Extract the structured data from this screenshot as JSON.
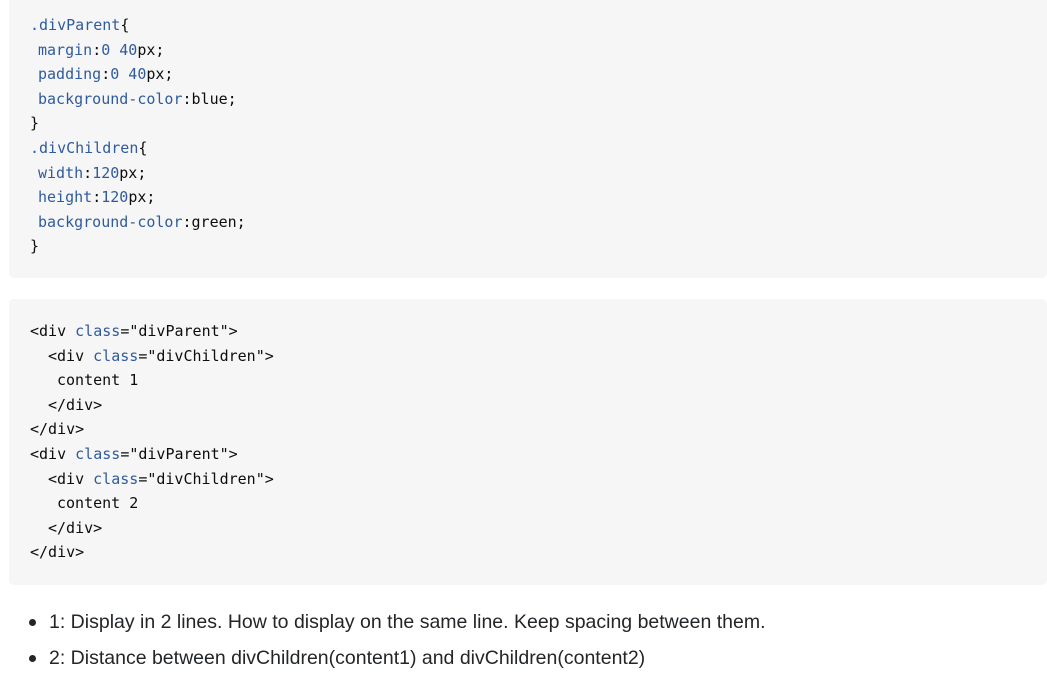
{
  "css_code": {
    "lines": [
      {
        "parts": [
          {
            "t": ".divParent",
            "c": "kw"
          },
          {
            "t": "{",
            "c": "plain"
          }
        ]
      },
      {
        "parts": [
          {
            "t": "margin",
            "c": "kw"
          },
          {
            "t": ":",
            "c": "plain"
          },
          {
            "t": "0 40",
            "c": "kw"
          },
          {
            "t": "px;",
            "c": "plain"
          }
        ]
      },
      {
        "parts": [
          {
            "t": "padding",
            "c": "kw"
          },
          {
            "t": ":",
            "c": "plain"
          },
          {
            "t": "0 40",
            "c": "kw"
          },
          {
            "t": "px;",
            "c": "plain"
          }
        ]
      },
      {
        "parts": [
          {
            "t": "background-color",
            "c": "kw"
          },
          {
            "t": ":blue;",
            "c": "plain"
          }
        ]
      },
      {
        "parts": [
          {
            "t": "}",
            "c": "plain"
          }
        ]
      },
      {
        "parts": [
          {
            "t": ".divChildren",
            "c": "kw"
          },
          {
            "t": "{",
            "c": "plain"
          }
        ]
      },
      {
        "parts": [
          {
            "t": "width",
            "c": "kw"
          },
          {
            "t": ":",
            "c": "plain"
          },
          {
            "t": "120",
            "c": "kw"
          },
          {
            "t": "px;",
            "c": "plain"
          }
        ]
      },
      {
        "parts": [
          {
            "t": "height",
            "c": "kw"
          },
          {
            "t": ":",
            "c": "plain"
          },
          {
            "t": "120",
            "c": "kw"
          },
          {
            "t": "px;",
            "c": "plain"
          }
        ]
      },
      {
        "parts": [
          {
            "t": "background-color",
            "c": "kw"
          },
          {
            "t": ":green;",
            "c": "plain"
          }
        ]
      },
      {
        "parts": [
          {
            "t": "}",
            "c": "plain"
          }
        ]
      }
    ]
  },
  "html_code": {
    "lines": [
      {
        "parts": [
          {
            "t": "<div ",
            "c": "plain"
          },
          {
            "t": "class",
            "c": "kw"
          },
          {
            "t": "=\"divParent\">",
            "c": "plain"
          }
        ]
      },
      {
        "parts": [
          {
            "t": "<div ",
            "c": "plain"
          },
          {
            "t": "class",
            "c": "kw"
          },
          {
            "t": "=\"divChildren\">",
            "c": "plain"
          }
        ]
      },
      {
        "parts": [
          {
            "t": "content 1",
            "c": "plain"
          }
        ]
      },
      {
        "parts": [
          {
            "t": "</div>",
            "c": "plain"
          }
        ]
      },
      {
        "parts": [
          {
            "t": "</div>",
            "c": "plain"
          }
        ]
      },
      {
        "parts": [
          {
            "t": "<div ",
            "c": "plain"
          },
          {
            "t": "class",
            "c": "kw"
          },
          {
            "t": "=\"divParent\">",
            "c": "plain"
          }
        ]
      },
      {
        "parts": [
          {
            "t": "<div ",
            "c": "plain"
          },
          {
            "t": "class",
            "c": "kw"
          },
          {
            "t": "=\"divChildren\">",
            "c": "plain"
          }
        ]
      },
      {
        "parts": [
          {
            "t": "content 2",
            "c": "plain"
          }
        ]
      },
      {
        "parts": [
          {
            "t": "</div>",
            "c": "plain"
          }
        ]
      },
      {
        "parts": [
          {
            "t": "</div>",
            "c": "plain"
          }
        ]
      }
    ]
  },
  "bullets": [
    {
      "text": "1: Display in 2 lines. How to display on the same line. Keep spacing between them."
    },
    {
      "text": "2: Distance between divChildren(content1) and divChildren(content2)"
    }
  ],
  "colors": {
    "code_background": "#f6f6f6",
    "keyword": "#2f5b9e",
    "text": "#0c0d0e",
    "body_text": "#232629"
  }
}
